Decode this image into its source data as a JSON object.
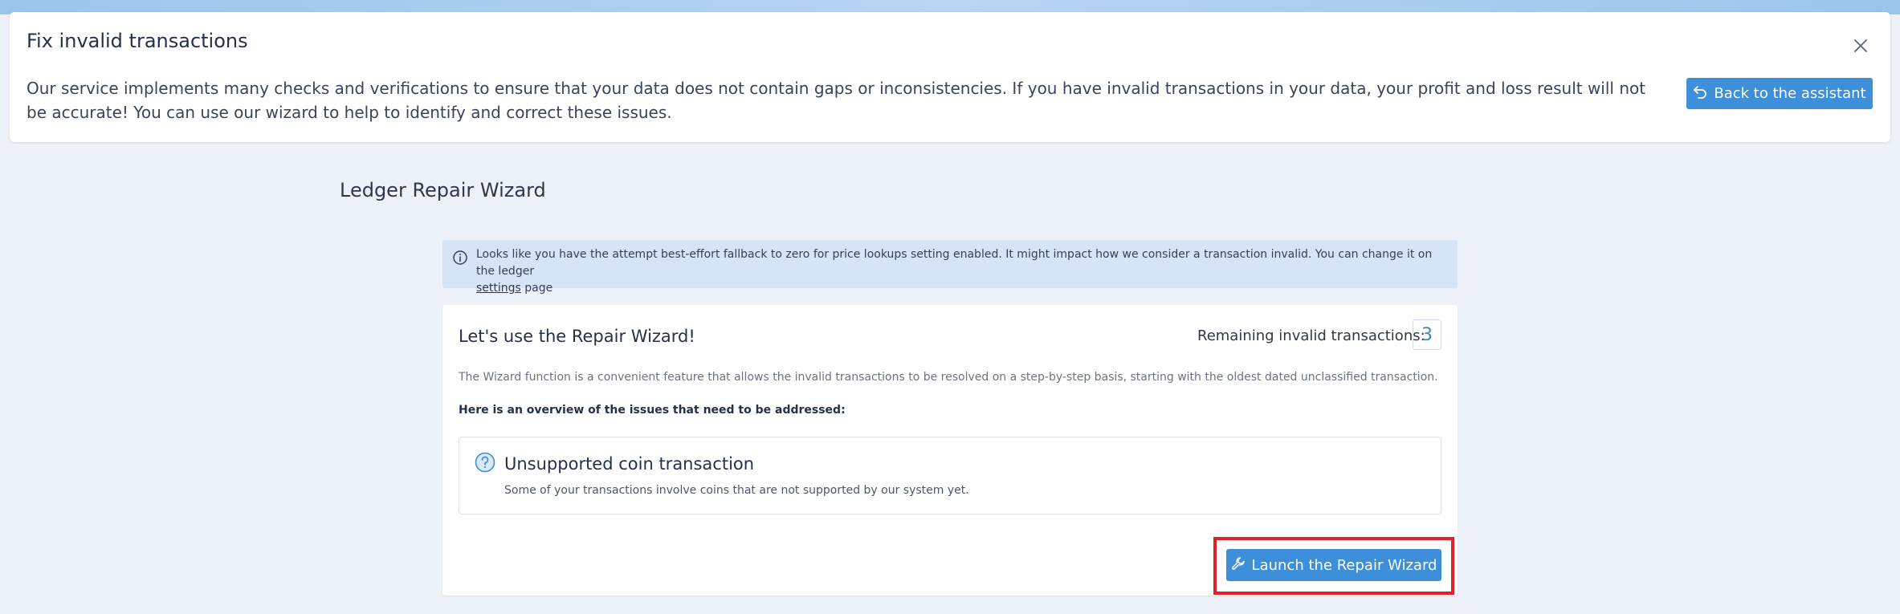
{
  "banner": {
    "title": "Fix invalid transactions",
    "description": "Our service implements many checks and verifications to ensure that your data does not contain gaps or inconsistencies. If you have invalid transactions in your data, your profit and loss result will not be accurate! You can use our wizard to help to identify and correct these issues.",
    "back_button_label": "Back to the assistant",
    "close_icon": "close-icon",
    "back_icon": "undo-arrow-icon"
  },
  "wizard": {
    "heading": "Ledger Repair Wizard",
    "info": {
      "text_before_link": "Looks like you have the attempt best-effort fallback to zero for price lookups setting enabled. It might impact how we consider a transaction invalid. You can change it on the ledger ",
      "link_label": "settings",
      "text_after_link": " page",
      "icon": "info-icon"
    },
    "card": {
      "title": "Let's use the Repair Wizard!",
      "remaining_label": "Remaining invalid transactions:",
      "remaining_count": "3",
      "description": "The Wizard function is a convenient feature that allows the invalid transactions to be resolved on a step-by-step basis, starting with the oldest dated unclassified transaction.",
      "overview_label": "Here is an overview of the issues that need to be addressed:",
      "issues": [
        {
          "icon": "question-icon",
          "title": "Unsupported coin transaction",
          "description": "Some of your transactions involve coins that are not supported by our system yet."
        }
      ],
      "launch_button_label": "Launch the Repair Wizard",
      "launch_icon": "wrench-icon"
    }
  },
  "colors": {
    "primary": "#3d8fd9",
    "page_background": "#edf2f9",
    "info_background": "#d6e4f7",
    "highlight": "#e0202a"
  }
}
